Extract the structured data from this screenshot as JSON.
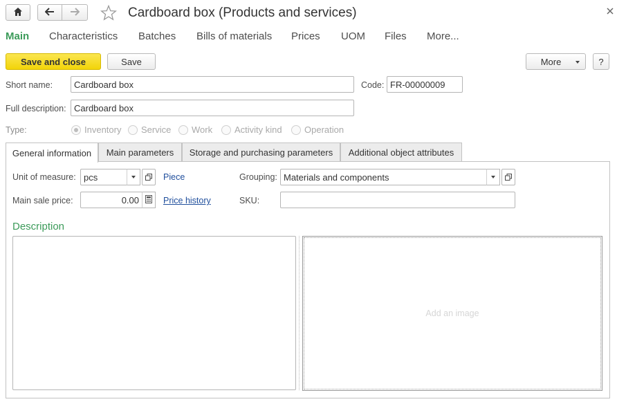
{
  "window": {
    "title": "Cardboard box (Products and services)",
    "home_icon": "home-icon",
    "back_icon": "arrow-left-icon",
    "forward_icon": "arrow-right-icon",
    "favorite_icon": "star-outline-icon",
    "close_icon": "close-icon"
  },
  "nav": {
    "items": [
      {
        "label": "Main",
        "active": true
      },
      {
        "label": "Characteristics"
      },
      {
        "label": "Batches"
      },
      {
        "label": "Bills of materials"
      },
      {
        "label": "Prices"
      },
      {
        "label": "UOM"
      },
      {
        "label": "Files"
      },
      {
        "label": "More..."
      }
    ]
  },
  "toolbar": {
    "save_close_label": "Save and close",
    "save_label": "Save",
    "more_label": "More",
    "help_label": "?"
  },
  "form": {
    "short_name_label": "Short name:",
    "short_name_value": "Cardboard box",
    "code_label": "Code:",
    "code_value": "FR-00000009",
    "full_description_label": "Full description:",
    "full_description_value": "Cardboard box",
    "type_label": "Type:",
    "type_options": [
      {
        "label": "Inventory",
        "selected": true
      },
      {
        "label": "Service"
      },
      {
        "label": "Work"
      },
      {
        "label": "Activity kind"
      },
      {
        "label": "Operation"
      }
    ]
  },
  "tabs": [
    {
      "label": "General information",
      "active": true
    },
    {
      "label": "Main parameters"
    },
    {
      "label": "Storage and purchasing parameters"
    },
    {
      "label": "Additional object attributes"
    }
  ],
  "general": {
    "uom_label": "Unit of measure:",
    "uom_value": "pcs",
    "uom_link": "Piece",
    "grouping_label": "Grouping:",
    "grouping_value": "Materials and components",
    "price_label": "Main sale price:",
    "price_value": "0.00",
    "price_history_link": "Price history",
    "sku_label": "SKU:",
    "sku_value": "",
    "description_heading": "Description",
    "description_value": "",
    "image_placeholder": "Add an image"
  },
  "colors": {
    "accent_green": "#3c9b5a",
    "primary_button": "#f5d809",
    "link_blue": "#1f4e9c"
  }
}
